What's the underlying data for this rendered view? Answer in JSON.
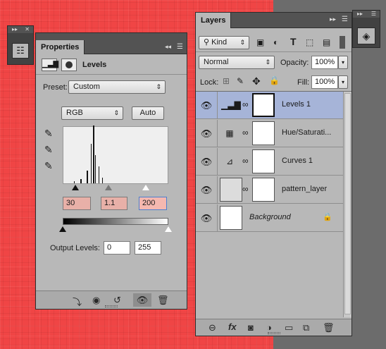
{
  "colors": {
    "canvas": "#f04545",
    "panel": "#b8b8b8",
    "selected_row": "#a6b4d8",
    "input_highlight": "#e8b0a8"
  },
  "properties": {
    "tab_label": "Properties",
    "adjustment_title": "Levels",
    "preset_label": "Preset:",
    "preset_value": "Custom",
    "channel_value": "RGB",
    "auto_label": "Auto",
    "input_black": "30",
    "input_gamma": "1.1",
    "input_white": "200",
    "output_label": "Output Levels:",
    "output_black": "0",
    "output_white": "255",
    "icons": [
      "levels-icon",
      "mask-icon",
      "black-eyedropper-icon",
      "gray-eyedropper-icon",
      "white-eyedropper-icon",
      "clip-to-layer-icon",
      "view-previous-icon",
      "reset-icon",
      "visibility-icon",
      "delete-icon"
    ]
  },
  "layers": {
    "tab_label": "Layers",
    "filter_kind": "Kind",
    "blend_mode": "Normal",
    "opacity_label": "Opacity:",
    "opacity_value": "100%",
    "lock_label": "Lock:",
    "fill_label": "Fill:",
    "fill_value": "100%",
    "items": [
      {
        "name": "Levels 1",
        "type": "levels",
        "selected": true
      },
      {
        "name": "Hue/Saturati...",
        "type": "hue-saturation",
        "selected": false
      },
      {
        "name": "Curves 1",
        "type": "curves",
        "selected": false
      },
      {
        "name": "pattern_layer",
        "type": "pixel",
        "selected": false
      },
      {
        "name": "Background",
        "type": "background",
        "selected": false,
        "locked": true
      }
    ],
    "footer_icons": [
      "link-layers-icon",
      "fx-icon",
      "add-mask-icon",
      "adjustment-layer-icon",
      "new-group-icon",
      "new-layer-icon",
      "delete-layer-icon"
    ]
  }
}
